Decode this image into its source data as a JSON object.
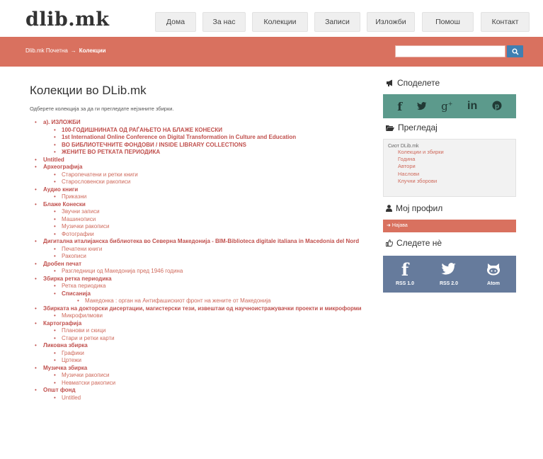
{
  "header": {
    "logo": "dlib.mk",
    "nav": [
      "Дома",
      "За нас",
      "Колекции",
      "Записи",
      "Изложби",
      "Помош",
      "Контакт"
    ]
  },
  "breadcrumb": {
    "home": "Dlib.mk Почетна",
    "separator": "→",
    "current": "Колекции"
  },
  "search": {
    "placeholder": "",
    "value": ""
  },
  "main": {
    "title": "Колекции во DLib.mk",
    "intro": "Одберете колекција за да ги прегледате нејзините збирки.",
    "collections": [
      {
        "label": "a). ИЗЛОЖБИ",
        "children": [
          {
            "label": "100-ГОДИШНИНАТА ОД РАЃАЊЕТО НА БЛАЖЕ КОНЕСКИ",
            "bold": true
          },
          {
            "label": "1st International Online Conference on Digital Transformation in Culture and Education",
            "bold": true
          },
          {
            "label": "ВО БИБЛИОТЕЧНИТЕ ФОНДОВИ / INSIDE LIBRARY COLLECTIONS",
            "bold": true
          },
          {
            "label": "ЖЕНИТЕ ВО РЕТКАТА ПЕРИОДИКА",
            "bold": true
          }
        ]
      },
      {
        "label": "Untitled",
        "children": []
      },
      {
        "label": "Археографија",
        "children": [
          {
            "label": "Старопечатени и ретки книги"
          },
          {
            "label": "Старословенски ракописи"
          }
        ]
      },
      {
        "label": "Аудио книги",
        "children": [
          {
            "label": "Приказни"
          }
        ]
      },
      {
        "label": "Блаже Конески",
        "children": [
          {
            "label": "Звучни записи"
          },
          {
            "label": "Машинописи"
          },
          {
            "label": "Музички ракописи"
          },
          {
            "label": "Фотографии"
          }
        ]
      },
      {
        "label": "Дигитална италијанска библиотека во Северна Македонија - BIM-Biblioteca digitale italiana in Macedonia del Nord",
        "children": [
          {
            "label": "Печатени книги"
          },
          {
            "label": "Ракописи"
          }
        ]
      },
      {
        "label": "Дробен печат",
        "children": [
          {
            "label": "Разгледници од Македонија пред 1946 година"
          }
        ]
      },
      {
        "label": "Збирка ретка периодика",
        "children": [
          {
            "label": "Ретка периодика"
          },
          {
            "label": "Списанија",
            "bold": true,
            "children": [
              {
                "label": "Македонка : орган на Антифашискиот фронт на жените от Македонија"
              }
            ]
          }
        ]
      },
      {
        "label": "Збирката на докторски дисертации, магистерски тези, извештаи од научноистражувачки проекти и микроформи",
        "children": [
          {
            "label": "Микрофилмови"
          }
        ]
      },
      {
        "label": "Картографија",
        "children": [
          {
            "label": "Планови и скици"
          },
          {
            "label": "Стари и ретки карти"
          }
        ]
      },
      {
        "label": "Ликовна збирка",
        "children": [
          {
            "label": "Графики"
          },
          {
            "label": "Цртежи"
          }
        ]
      },
      {
        "label": "Музичка збирка",
        "children": [
          {
            "label": "Музички ракописи"
          },
          {
            "label": "Невматски ракописи"
          }
        ]
      },
      {
        "label": "Општ фонд",
        "children": [
          {
            "label": "Untitled"
          }
        ]
      }
    ]
  },
  "sidebar": {
    "share": {
      "heading": "Споделете",
      "icon": "megaphone-icon",
      "networks": [
        "facebook-icon",
        "twitter-icon",
        "google-plus-icon",
        "linkedin-icon",
        "pinterest-icon"
      ]
    },
    "browse": {
      "heading": "Прегледај",
      "icon": "folder-open-icon",
      "title": "Сиот DLib.mk",
      "items": [
        "Колекции и збирки",
        "Година",
        "Автори",
        "Наслови",
        "Клучни зборови"
      ]
    },
    "profile": {
      "heading": "Мој профил",
      "icon": "user-icon",
      "login_label": "Најава",
      "login_icon": "login-icon"
    },
    "follow": {
      "heading": "Следете нè",
      "icon": "thumbs-up-icon",
      "feeds": [
        {
          "label": "RSS 1.0",
          "icon": "facebook-icon"
        },
        {
          "label": "RSS 2.0",
          "icon": "twitter-icon"
        },
        {
          "label": "Atom",
          "icon": "github-icon"
        }
      ]
    }
  },
  "colors": {
    "accent": "#d9715f",
    "link": "#c0504d",
    "share_bg": "#5c9a8c",
    "rss_bg": "#667b9c",
    "search_button": "#3f7fb2"
  }
}
